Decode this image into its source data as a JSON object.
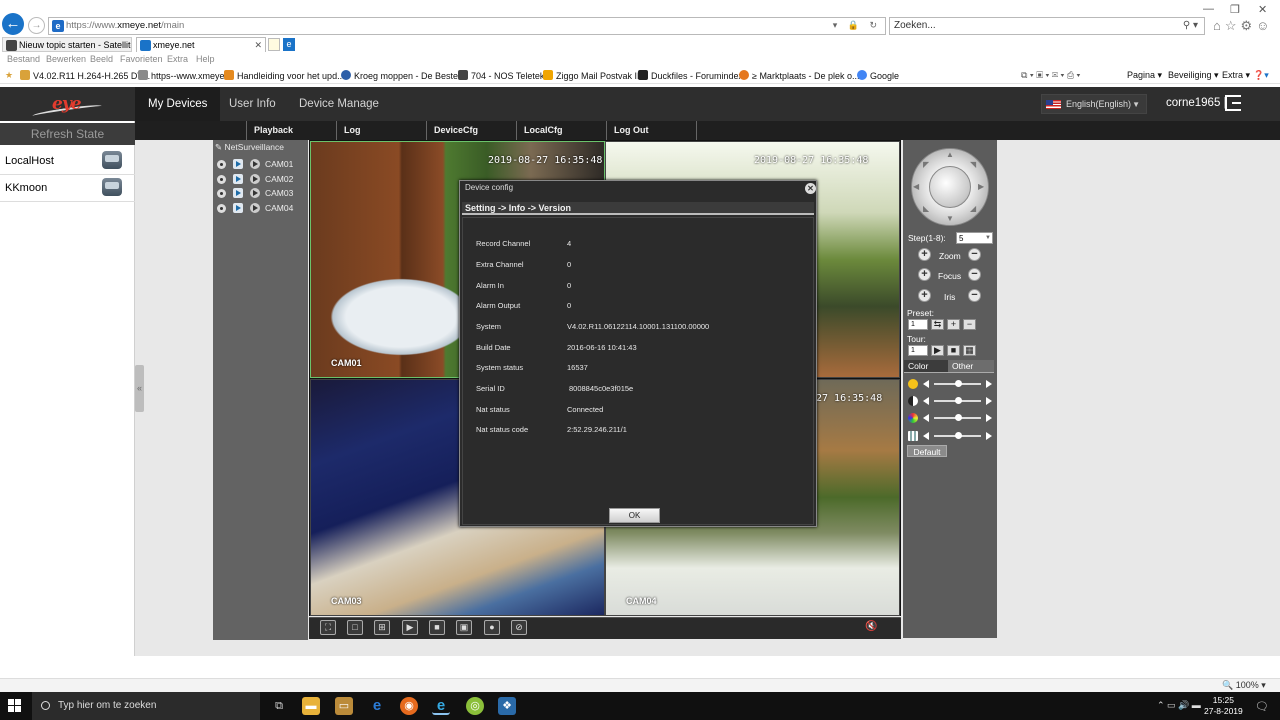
{
  "browser": {
    "url_prefix": "https://www.",
    "url_domain": "xmeye.net",
    "url_path": "/main",
    "search_placeholder": "Zoeken...",
    "tabs": [
      {
        "label": "Nieuw topic starten - Satellite ..."
      },
      {
        "label": "xmeye.net"
      }
    ],
    "menu": [
      "Bestand",
      "Bewerken",
      "Beeld",
      "Favorieten",
      "Extra",
      "Help"
    ],
    "favorites": [
      {
        "label": "V4.02.R11 H.264-H.265 DV...",
        "color": "#d9a23a"
      },
      {
        "label": "https--www.xmeye",
        "color": "#8a8a8a"
      },
      {
        "label": "Handleiding voor het upd...",
        "color": "#e58a1f"
      },
      {
        "label": "Kroeg moppen - De Beste ...",
        "color": "#2d5fa8"
      },
      {
        "label": "704 - NOS Teletekst",
        "color": "#444444"
      },
      {
        "label": "Ziggo Mail Postvak IN",
        "color": "#f0a500"
      },
      {
        "label": "Duckfiles - Forumindex",
        "color": "#222222"
      },
      {
        "label": "≥ Marktplaats - De plek o...",
        "color": "#e5771e"
      },
      {
        "label": "Google",
        "color": "#4285f4"
      }
    ],
    "command_bar": [
      "Pagina ▾",
      "Beveiliging ▾",
      "Extra ▾"
    ],
    "zoom": "100%"
  },
  "app": {
    "nav": [
      {
        "label": "My Devices",
        "active": true
      },
      {
        "label": "User Info",
        "active": false
      },
      {
        "label": "Device Manage",
        "active": false
      }
    ],
    "language": "English(English)",
    "username": "corne1965",
    "separator": "|",
    "refresh_label": "Refresh State",
    "devices": [
      {
        "label": "LocalHost"
      },
      {
        "label": "KKmoon"
      }
    ],
    "toolbar": [
      "Playback",
      "Log",
      "DeviceCfg",
      "LocalCfg",
      "Log Out"
    ],
    "net_panel_title": "NetSurveillance",
    "cameras": [
      "CAM01",
      "CAM02",
      "CAM03",
      "CAM04"
    ],
    "cam_timestamps": [
      "2019-08-27 16:35:48",
      "2019-08-27 16:35:48",
      "27 16:35:48"
    ],
    "ptz": {
      "step_label": "Step(1-8):",
      "step_value": "5",
      "zoom_label": "Zoom",
      "focus_label": "Focus",
      "iris_label": "Iris",
      "preset_label": "Preset:",
      "preset_value": "1",
      "tour_label": "Tour:",
      "tour_value": "1",
      "tabs": [
        "Color",
        "Other"
      ],
      "default_label": "Default",
      "sliders": [
        0.5,
        0.5,
        0.5,
        0.5
      ]
    }
  },
  "dialog": {
    "title": "Device config",
    "breadcrumb": "Setting -> Info -> Version",
    "rows": [
      {
        "key": "Record Channel",
        "value": "4"
      },
      {
        "key": "Extra Channel",
        "value": "0"
      },
      {
        "key": "Alarm In",
        "value": "0"
      },
      {
        "key": "Alarm Output",
        "value": "0"
      },
      {
        "key": "System",
        "value": "V4.02.R11.06122114.10001.131100.00000"
      },
      {
        "key": "Build Date",
        "value": "2016-06-16 10:41:43"
      },
      {
        "key": "System status",
        "value": "16537"
      },
      {
        "key": "Serial ID",
        "value": "8008845c0e3f015e"
      },
      {
        "key": "Nat status",
        "value": "Connected"
      },
      {
        "key": "Nat status code",
        "value": "2:52.29.246.211/1"
      }
    ],
    "ok_label": "OK"
  },
  "taskbar": {
    "search_placeholder": "Typ hier om te zoeken",
    "time": "15:25",
    "date": "27-8-2019"
  }
}
